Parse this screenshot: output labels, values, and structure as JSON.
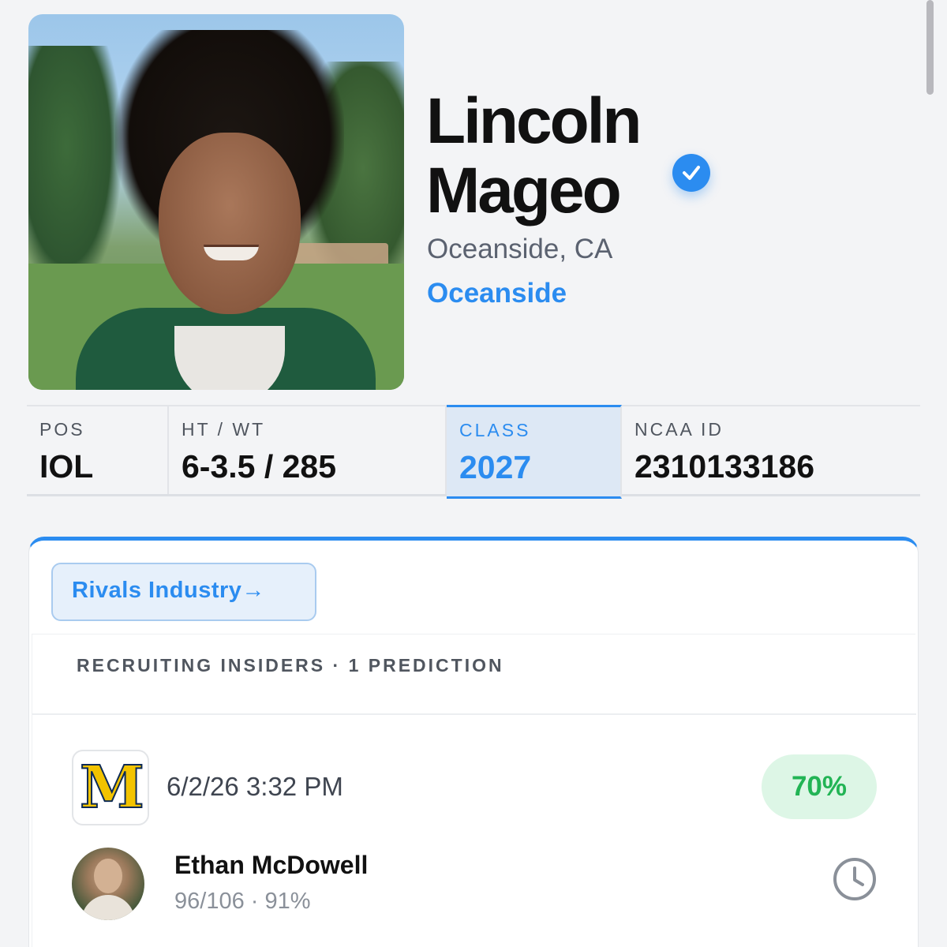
{
  "player": {
    "first_name": "Lincoln",
    "last_name": "Mageo",
    "verified_icon": "check-circle-icon",
    "hometown": "Oceanside, CA",
    "school": "Oceanside"
  },
  "stats": [
    {
      "label": "POS",
      "value": "IOL"
    },
    {
      "label": "HT / WT",
      "value": "6-3.5 / 285"
    },
    {
      "label": "CLASS",
      "value": "2027"
    },
    {
      "label": "NCAA ID",
      "value": "2310133186"
    }
  ],
  "card": {
    "button_label": "Rivals Industry→",
    "insiders_heading": "RECRUITING INSIDERS · 1 PREDICTION",
    "prediction": {
      "team_letter": "M",
      "team_icon": "michigan-logo",
      "date": "6/2/26 3:32 PM",
      "confidence": "70%",
      "insider_name": "Ethan McDowell",
      "insider_record": "96/106 · 91%",
      "status_icon": "clock-icon"
    }
  },
  "colors": {
    "accent": "#2b8cf0",
    "confidence": "#22b455",
    "confidence_bg": "#ddf6e6",
    "michigan_maize": "#f2c300",
    "michigan_blue": "#0d2a55"
  }
}
